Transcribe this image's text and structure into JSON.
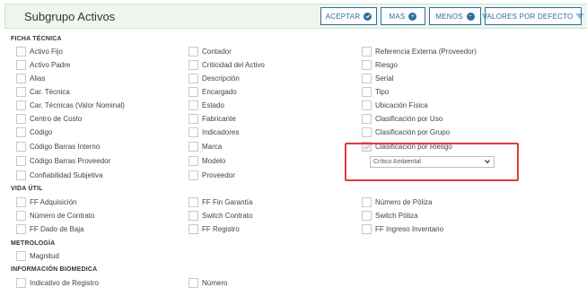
{
  "header": {
    "title": "Subgrupo Activos",
    "buttons": {
      "aceptar": "ACEPTAR",
      "mas": "MAS",
      "menos": "MENOS",
      "valores": "VALORES POR DEFECTO"
    }
  },
  "sections": {
    "ficha": "FICHA TÉCNICA",
    "vida": "VIDA ÚTIL",
    "metrologia": "METROLOGÍA",
    "biomedica": "INFORMACIÓN BIOMEDICA"
  },
  "ficha": {
    "col1": [
      "Activo Fijo",
      "Activo Padre",
      "Alias",
      "Car. Técnica",
      "Car. Técnicas (Valor Nominal)",
      "Centro de Costo",
      "Código",
      "Código Barras Interno",
      "Código Barras Proveedor",
      "Confiabilidad Subjetiva"
    ],
    "col2": [
      "Contador",
      "Criticidad del Activo",
      "Descripción",
      "Encargado",
      "Estado",
      "Fabricante",
      "Indicadores",
      "Marca",
      "Modelo",
      "Proveedor"
    ],
    "col3": [
      "Referencia Externa (Proveedor)",
      "Riesgo",
      "Serial",
      "Tipo",
      "Ubicación Física",
      "Clasificación por Uso",
      "Clasificación por Grupo",
      "Clasificación por Riesgo"
    ]
  },
  "riesgo_select": {
    "value": "Crítico Ambiental",
    "checked": true
  },
  "vida": {
    "col1": [
      "FF Adquisición",
      "Número de Contrato",
      "FF Dado de Baja"
    ],
    "col2": [
      "FF Fin Garantía",
      "Switch Contrato",
      "FF Registro"
    ],
    "col3": [
      "Número de Póliza",
      "Switch Póliza",
      "FF Ingreso Inventario"
    ]
  },
  "metrologia": {
    "col1": [
      "Magnitud"
    ]
  },
  "biomedica": {
    "col1": [
      "Indicativo de Registro"
    ],
    "col2": [
      "Número"
    ]
  },
  "colors": {
    "accent": "#2e6da4",
    "header_bg": "#eef7ee",
    "highlight": "#e53935"
  }
}
